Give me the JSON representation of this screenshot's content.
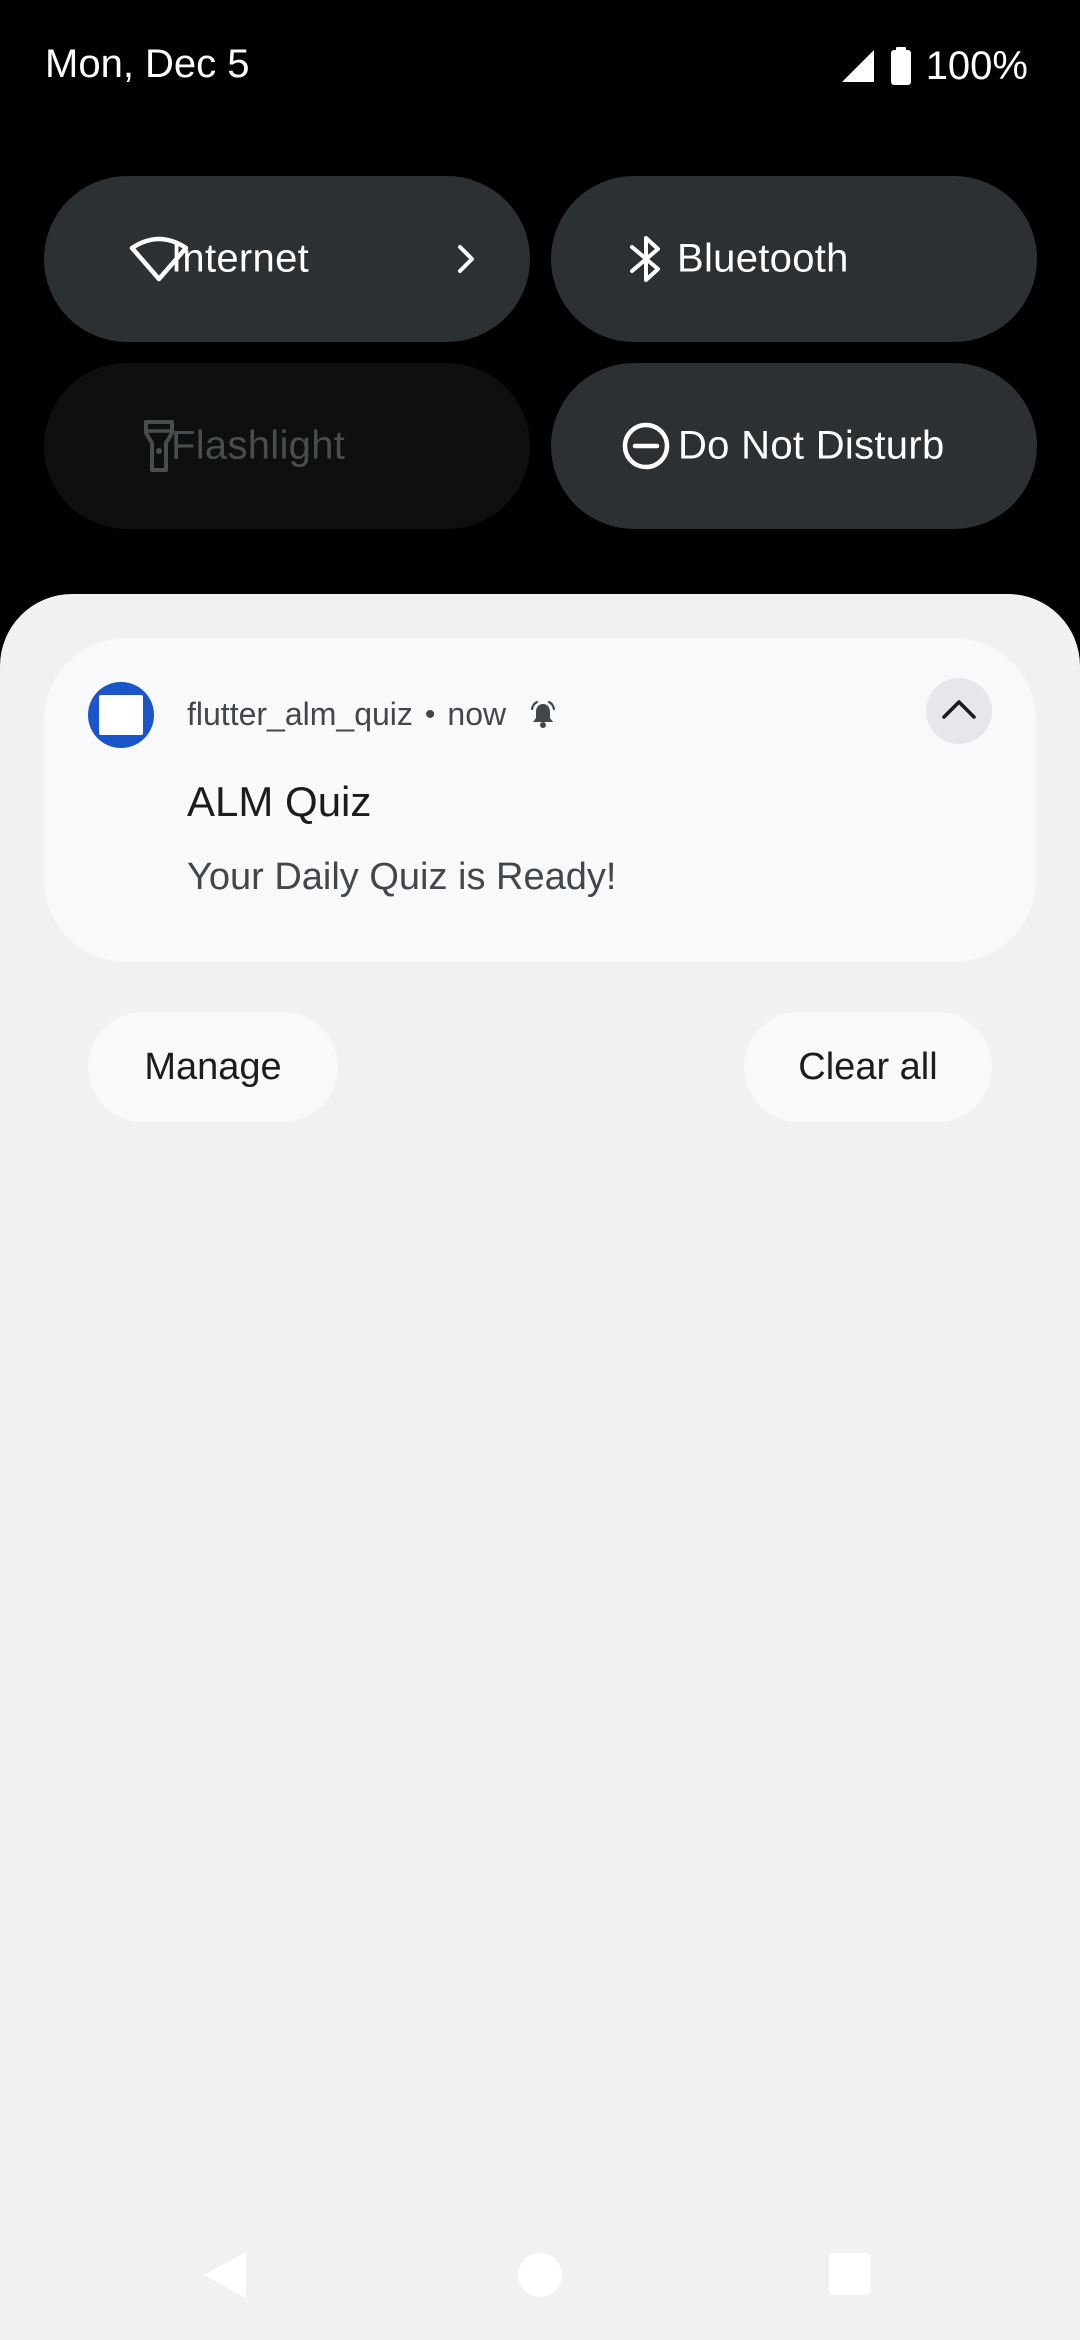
{
  "status_bar": {
    "date": "Mon, Dec 5",
    "signal_icon": "signal-icon",
    "battery_icon": "battery-icon",
    "battery_level": "100%"
  },
  "quick_settings": {
    "tiles": [
      {
        "label": "Internet",
        "icon": "wifi-icon",
        "state": "on",
        "has_chevron": true
      },
      {
        "label": "Bluetooth",
        "icon": "bluetooth-icon",
        "state": "on"
      },
      {
        "label": "Flashlight",
        "icon": "flashlight-icon",
        "state": "off"
      },
      {
        "label": "Do Not Disturb",
        "icon": "do-not-disturb-icon",
        "state": "on"
      }
    ]
  },
  "notification": {
    "app_name": "flutter_alm_quiz",
    "separator": "•",
    "time": "now",
    "alert_icon": "bell-icon",
    "title": "ALM Quiz",
    "text": "Your Daily Quiz is Ready!",
    "expand_icon": "chevron-up-icon"
  },
  "actions": {
    "manage_label": "Manage",
    "clear_all_label": "Clear all"
  },
  "nav_bar": {
    "back_icon": "back-icon",
    "home_icon": "home-icon",
    "recents_icon": "recents-icon"
  },
  "colors": {
    "shade_background": "#f0f1f3",
    "tile_active": "#2d3033",
    "tile_inactive": "#0e0f0f",
    "app_icon": "#1a56c9"
  }
}
